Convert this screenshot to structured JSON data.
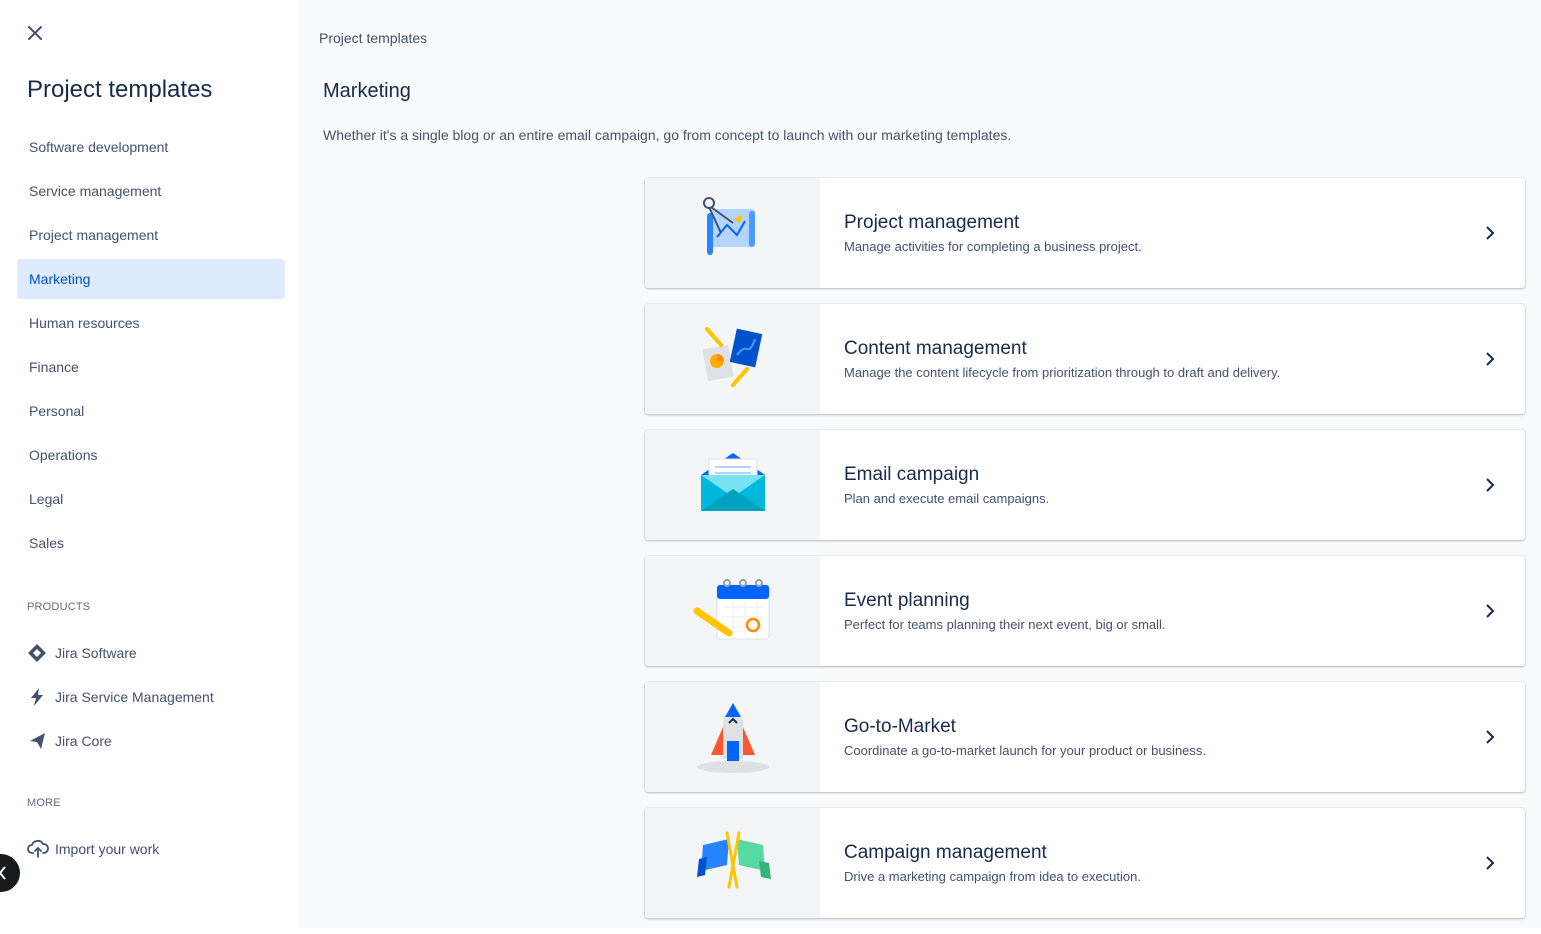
{
  "sidebar": {
    "close_icon": "close-icon",
    "title": "Project templates",
    "categories": [
      {
        "label": "Software development",
        "selected": false
      },
      {
        "label": "Service management",
        "selected": false
      },
      {
        "label": "Project management",
        "selected": false
      },
      {
        "label": "Marketing",
        "selected": true
      },
      {
        "label": "Human resources",
        "selected": false
      },
      {
        "label": "Finance",
        "selected": false
      },
      {
        "label": "Personal",
        "selected": false
      },
      {
        "label": "Operations",
        "selected": false
      },
      {
        "label": "Legal",
        "selected": false
      },
      {
        "label": "Sales",
        "selected": false
      }
    ],
    "products_heading": "PRODUCTS",
    "products": [
      {
        "label": "Jira Software",
        "icon": "jira-software-icon"
      },
      {
        "label": "Jira Service Management",
        "icon": "jira-service-management-icon"
      },
      {
        "label": "Jira Core",
        "icon": "jira-core-icon"
      }
    ],
    "more_heading": "MORE",
    "more": [
      {
        "label": "Import your work",
        "icon": "cloud-upload-icon"
      }
    ]
  },
  "main": {
    "breadcrumb": "Project templates",
    "title": "Marketing",
    "description": "Whether it's a single blog or an entire email campaign, go from concept to launch with our marketing templates.",
    "templates": [
      {
        "title": "Project management",
        "description": "Manage activities for completing a business project.",
        "icon": "blueprint-illustration"
      },
      {
        "title": "Content management",
        "description": "Manage the content lifecycle from prioritization through to draft and delivery.",
        "icon": "documents-illustration"
      },
      {
        "title": "Email campaign",
        "description": "Plan and execute email campaigns.",
        "icon": "envelope-illustration"
      },
      {
        "title": "Event planning",
        "description": "Perfect for teams planning their next event, big or small.",
        "icon": "calendar-illustration"
      },
      {
        "title": "Go-to-Market",
        "description": "Coordinate a go-to-market launch for your product or business.",
        "icon": "rocket-illustration"
      },
      {
        "title": "Campaign management",
        "description": "Drive a marketing campaign from idea to execution.",
        "icon": "flags-illustration"
      }
    ]
  },
  "colors": {
    "accent": "#0052cc",
    "selected_bg": "#deebff",
    "text": "#172b4d",
    "subtext": "#42526e",
    "main_bg": "#f9fafb"
  }
}
